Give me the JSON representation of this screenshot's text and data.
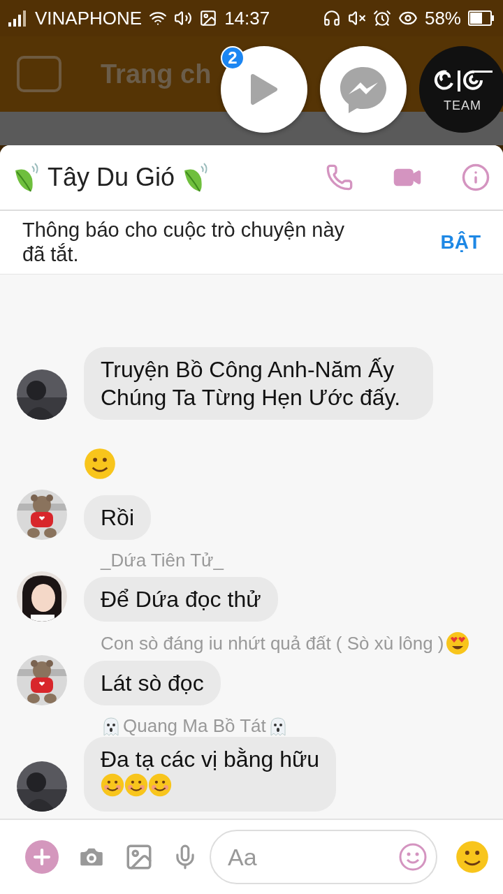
{
  "status_bar": {
    "carrier": "VINAPHONE",
    "time": "14:37",
    "battery": "58%"
  },
  "background_app": {
    "title": "Trang ch"
  },
  "chat_heads": {
    "badge": "2",
    "logo_caption": "TEAM"
  },
  "conversation": {
    "title": "Tây Du Gió",
    "notice": "Thông báo cho cuộc trò chuyện này đã tắt.",
    "notice_action": "BẬT"
  },
  "messages": [
    {
      "kind": "text",
      "avatar": {
        "kind": "dark"
      },
      "text": "Truyện Bồ Công Anh-Năm Ấy Chúng Ta Từng Hẹn Ước đấy."
    },
    {
      "kind": "emoji"
    },
    {
      "kind": "text",
      "avatar": {
        "kind": "bear"
      },
      "text": "Rồi"
    },
    {
      "kind": "text",
      "avatar": {
        "kind": "person"
      },
      "sender": {
        "name": "_Dứa Tiên Tử_",
        "kind": "plain"
      },
      "text": "Để Dứa đọc thử"
    },
    {
      "kind": "text",
      "avatar": {
        "kind": "bear"
      },
      "sender": {
        "name": "Con sò đáng iu nhứt quả đất ( Sò xù lông )",
        "kind": "heart"
      },
      "text": "Lát sò đọc"
    },
    {
      "kind": "text-emoji",
      "avatar": {
        "kind": "dark"
      },
      "sender": {
        "name": "Quang Ma Bồ Tát",
        "kind": "ghost"
      },
      "text": "Đa tạ các vị bằng hữu"
    }
  ],
  "composer": {
    "placeholder": "Aa"
  }
}
